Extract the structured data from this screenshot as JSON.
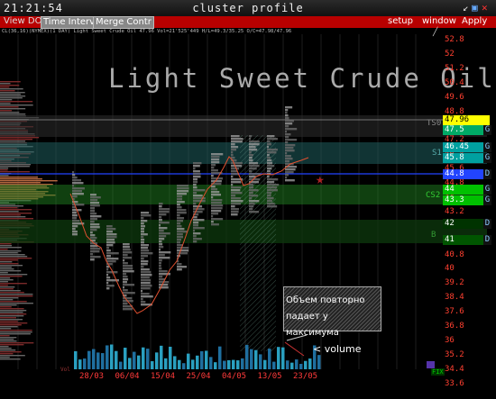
{
  "window": {
    "time": "21:21:54",
    "title": "cluster profile"
  },
  "toolbar": {
    "view_dom": "View DOM",
    "time_interval": "Time Interval",
    "merge_contr": "Merge Contr",
    "setup": "setup",
    "window": "window",
    "apply": "Apply"
  },
  "info_line": "CL(36,16)(NYMEX)(1 DAY) Light Sweet Crude Oil 47.96 Vol=21'525'449 H/L=49.3/35.25 O/C=47.98/47.96",
  "chart_title": "Light Sweet Crude Oil",
  "price_axis": [
    "52.8",
    "52",
    "51.2",
    "50.4",
    "49.6",
    "48.8",
    "48",
    "47.2",
    "46.4",
    "45.6",
    "44.8",
    "44",
    "43.2",
    "42.4",
    "41.6",
    "40.8",
    "40",
    "39.2",
    "38.4",
    "37.6",
    "36.8",
    "36",
    "35.2",
    "34.4",
    "33.6"
  ],
  "date_axis": [
    "28/03",
    "06/04",
    "15/04",
    "25/04",
    "04/05",
    "13/05",
    "23/05"
  ],
  "price_tags": [
    {
      "label": "47.96",
      "color": "#ffff00",
      "text": "#000",
      "g": ""
    },
    {
      "label": "47.5",
      "color": "#00aa66",
      "text": "#fff",
      "g": "G"
    },
    {
      "label": "46.45",
      "color": "#00a0a0",
      "text": "#fff",
      "g": "G"
    },
    {
      "label": "45.8",
      "color": "#00a0a0",
      "text": "#fff",
      "g": "G"
    },
    {
      "label": "44.8",
      "color": "#2244ff",
      "text": "#fff",
      "g": "D"
    },
    {
      "label": "44",
      "color": "#00c000",
      "text": "#fff",
      "g": "G"
    },
    {
      "label": "43.3",
      "color": "#00c000",
      "text": "#fff",
      "g": "G"
    },
    {
      "label": "42",
      "color": "#003300",
      "text": "#fff",
      "g": "D"
    },
    {
      "label": "41",
      "color": "#005500",
      "text": "#fff",
      "g": "D"
    }
  ],
  "band_labels": {
    "ts0": "TS0",
    "s1": "S1",
    "cs2": "CS2",
    "b": "B"
  },
  "annotation": {
    "line1": "Объем повторно",
    "line2": "падает у максимума"
  },
  "volume_label": "< volume",
  "bottom_left_label": "Vol",
  "fix_label": "FIX",
  "colors": {
    "toolbar": "#b80000",
    "axis": "#ff4030",
    "ts0": "#aaaaaa",
    "s1": "#3fbfbf",
    "cs2": "#2ecc40",
    "blue_line": "#2244ff"
  }
}
